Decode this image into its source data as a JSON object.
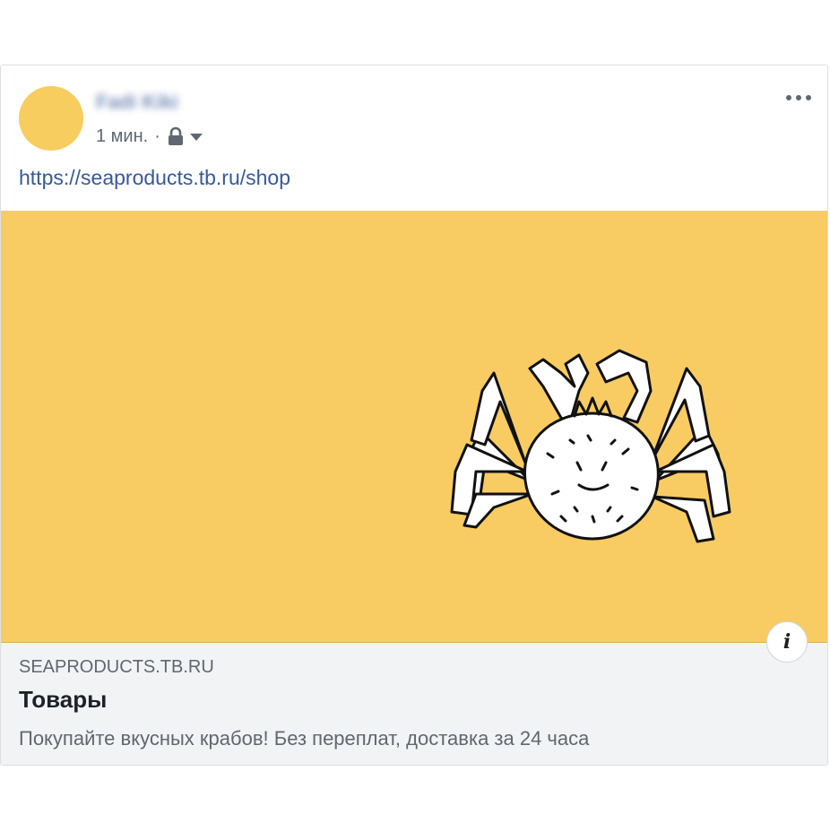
{
  "post": {
    "author_name": "Fadi Kiki",
    "timestamp": "1 мин.",
    "separator": "·",
    "privacy_icon": "lock-icon",
    "menu_icon": "more-horizontal-icon",
    "link_text": "https://seaproducts.tb.ru/shop"
  },
  "link_preview": {
    "image_description_icon": "crab-illustration",
    "domain": "SEAPRODUCTS.TB.RU",
    "title": "Товары",
    "description": "Покупайте вкусных крабов! Без переплат, доставка за 24 часа",
    "info_icon": "i"
  },
  "colors": {
    "avatar": "#f7cd5f",
    "image_background": "#f8cc62",
    "link": "#385898",
    "footer_background": "#f2f3f5"
  }
}
